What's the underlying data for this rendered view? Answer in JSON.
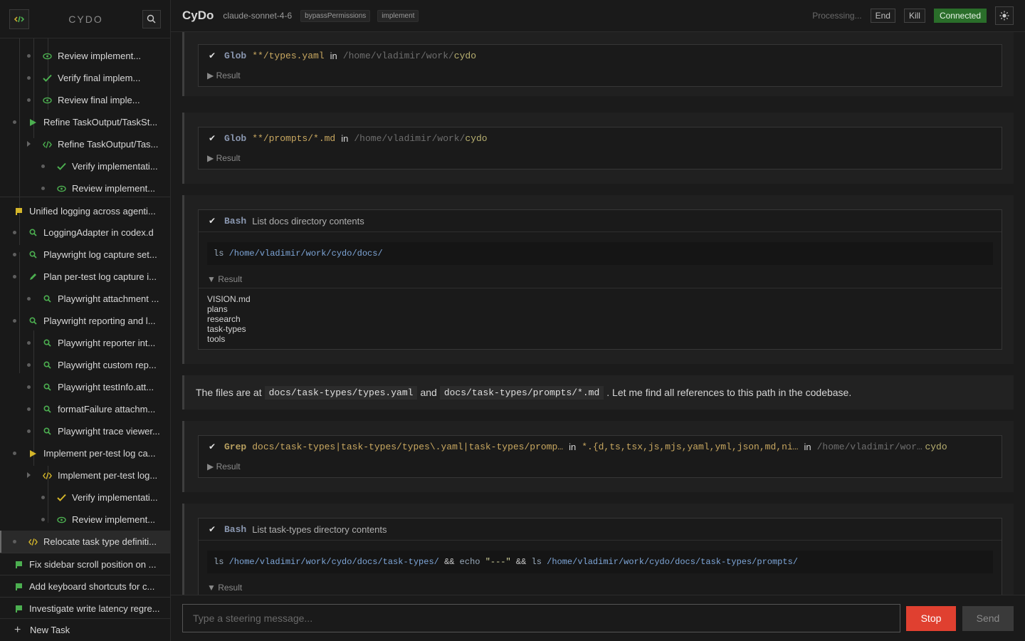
{
  "sidebar": {
    "app_name": "CYDO",
    "new_task_label": "New Task",
    "items": [
      {
        "label": "Review implement...",
        "icon": "eye-icon"
      },
      {
        "label": "Verify final implem...",
        "icon": "check-icon"
      },
      {
        "label": "Review final imple...",
        "icon": "eye-icon"
      },
      {
        "label": "Refine TaskOutput/TaskSt...",
        "icon": "play-icon"
      },
      {
        "label": "Refine TaskOutput/Tas...",
        "icon": "code-icon"
      },
      {
        "label": "Verify implementati...",
        "icon": "check-icon"
      },
      {
        "label": "Review implement...",
        "icon": "eye-icon"
      },
      {
        "label": "Unified logging across agenti...",
        "icon": "flag-icon"
      },
      {
        "label": "LoggingAdapter in codex.d",
        "icon": "search-icon"
      },
      {
        "label": "Playwright log capture set...",
        "icon": "search-icon"
      },
      {
        "label": "Plan per-test log capture i...",
        "icon": "pencil-icon"
      },
      {
        "label": "Playwright attachment ...",
        "icon": "search-icon"
      },
      {
        "label": "Playwright reporting and l...",
        "icon": "search-icon"
      },
      {
        "label": "Playwright reporter int...",
        "icon": "search-icon"
      },
      {
        "label": "Playwright custom rep...",
        "icon": "search-icon"
      },
      {
        "label": "Playwright testInfo.att...",
        "icon": "search-icon"
      },
      {
        "label": "formatFailure attachm...",
        "icon": "search-icon"
      },
      {
        "label": "Playwright trace viewer...",
        "icon": "search-icon"
      },
      {
        "label": "Implement per-test log ca...",
        "icon": "play-icon"
      },
      {
        "label": "Implement per-test log...",
        "icon": "code-icon"
      },
      {
        "label": "Verify implementati...",
        "icon": "check-icon"
      },
      {
        "label": "Review implement...",
        "icon": "eye-icon"
      },
      {
        "label": "Relocate task type definiti...",
        "icon": "code-icon"
      },
      {
        "label": "Fix sidebar scroll position on ...",
        "icon": "flag-icon"
      },
      {
        "label": "Add keyboard shortcuts for c...",
        "icon": "flag-icon"
      },
      {
        "label": "Investigate write latency regre...",
        "icon": "flag-icon"
      }
    ]
  },
  "topbar": {
    "title": "CyDo",
    "model": "claude-sonnet-4-6",
    "tag1": "bypassPermissions",
    "tag2": "implement",
    "status": "Processing...",
    "end_label": "End",
    "kill_label": "Kill",
    "connected_label": "Connected"
  },
  "conversation": {
    "glob1": {
      "tool": "Glob",
      "pattern": "**/types.yaml",
      "in": "in",
      "path_prefix": "/home/vladimir/work/",
      "path_last": "cydo",
      "result": "▶ Result"
    },
    "glob2": {
      "tool": "Glob",
      "pattern": "**/prompts/*.md",
      "in": "in",
      "path_prefix": "/home/vladimir/work/",
      "path_last": "cydo",
      "result": "▶ Result"
    },
    "bash1": {
      "tool": "Bash",
      "desc": "List docs directory contents",
      "cmd": "ls",
      "arg": "/home/vladimir/work/cydo/docs/",
      "result": "▼ Result",
      "output": [
        "VISION.md",
        "plans",
        "research",
        "task-types",
        "tools"
      ]
    },
    "text1": {
      "before": "The files are at",
      "code1": "docs/task-types/types.yaml",
      "mid": "and",
      "code2": "docs/task-types/prompts/*.md",
      "after": ". Let me find all references to this path in the codebase."
    },
    "grep1": {
      "tool": "Grep",
      "pattern": "docs/task-types|task-types/types\\.yaml|task-types/promp…",
      "in1": "in",
      "glob": "*.{d,ts,tsx,js,mjs,yaml,yml,json,md,ni…",
      "in2": "in",
      "path_prefix": "/home/vladimir/wor…",
      "path_last": "cydo",
      "result": "▶ Result"
    },
    "bash2": {
      "tool": "Bash",
      "desc": "List task-types directory contents",
      "cmd1": "ls",
      "arg1": "/home/vladimir/work/cydo/docs/task-types/",
      "op1": "&&",
      "cmd2": "echo",
      "str": "\"---\"",
      "op2": "&&",
      "cmd3": "ls",
      "arg3": "/home/vladimir/work/cydo/docs/task-types/prompts/",
      "result": "▼ Result"
    }
  },
  "composer": {
    "placeholder": "Type a steering message...",
    "stop_label": "Stop",
    "send_label": "Send"
  },
  "colors": {
    "green": "#4caf50",
    "yellow": "#d4b62a",
    "connected": "#2a6e2a",
    "stop": "#e04030"
  }
}
